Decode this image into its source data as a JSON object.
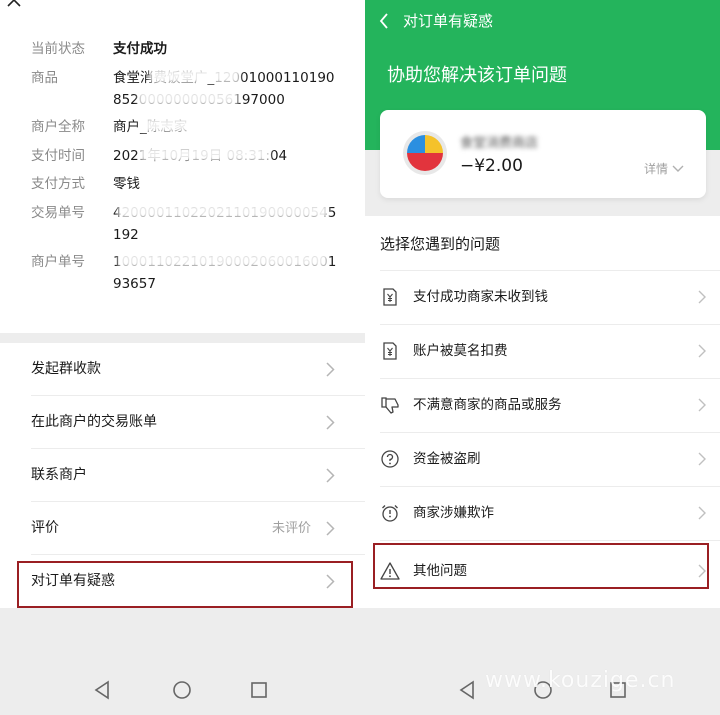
{
  "left": {
    "info": [
      {
        "label": "当前状态",
        "value": "支付成功"
      },
      {
        "label": "商品",
        "value": "食堂消费饭堂广_1200100011019085200000000056197000"
      },
      {
        "label": "商户全称",
        "value": "商户_陈志家"
      },
      {
        "label": "支付时间",
        "value": "2021年10月19日 08:31:04"
      },
      {
        "label": "支付方式",
        "value": "零钱"
      },
      {
        "label": "交易单号",
        "value": "42000011022021101900000545192"
      },
      {
        "label": "商户单号",
        "value": "1000110221019000206001600193657"
      }
    ],
    "menu": [
      {
        "label": "发起群收款",
        "sub": ""
      },
      {
        "label": "在此商户的交易账单",
        "sub": ""
      },
      {
        "label": "联系商户",
        "sub": ""
      },
      {
        "label": "评价",
        "sub": "未评价"
      },
      {
        "label": "对订单有疑惑",
        "sub": ""
      }
    ]
  },
  "right": {
    "header": {
      "title": "对订单有疑惑",
      "headline": "协助您解决该订单问题"
    },
    "card": {
      "merchant": "食堂消费商店",
      "amount": "−¥2.00",
      "detail": "详情"
    },
    "section_title": "选择您遇到的问题",
    "problems": [
      {
        "label": "支付成功商家未收到钱",
        "icon": "yen-doc-icon"
      },
      {
        "label": "账户被莫名扣费",
        "icon": "yen-doc-icon"
      },
      {
        "label": "不满意商家的商品或服务",
        "icon": "thumb-down-icon"
      },
      {
        "label": "资金被盗刷",
        "icon": "question-circle-icon"
      },
      {
        "label": "商家涉嫌欺诈",
        "icon": "alarm-clock-icon"
      },
      {
        "label": "其他问题",
        "icon": "warning-triangle-icon"
      }
    ],
    "watermark": "www.kouzige.cn"
  },
  "colors": {
    "brand_green": "#24b45c",
    "highlight_red": "#9a1f23"
  }
}
